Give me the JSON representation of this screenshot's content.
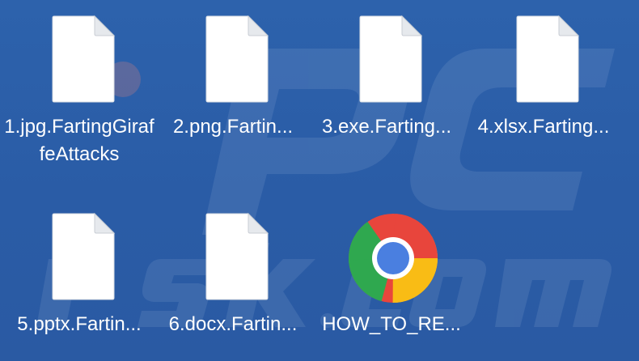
{
  "desktop": {
    "background_color": "#2b5ea8",
    "watermark_text": "PC risk.com",
    "files": [
      {
        "name": "1.jpg.FartingGiraffeAttacks",
        "icon": "blank-file-icon"
      },
      {
        "name": "2.png.Fartin...",
        "icon": "blank-file-icon"
      },
      {
        "name": "3.exe.Farting...",
        "icon": "blank-file-icon"
      },
      {
        "name": "4.xlsx.Farting...",
        "icon": "blank-file-icon"
      },
      {
        "name": "5.pptx.Fartin...",
        "icon": "blank-file-icon"
      },
      {
        "name": "6.docx.Fartin...",
        "icon": "blank-file-icon"
      },
      {
        "name": "HOW_TO_RE...",
        "icon": "chrome-icon"
      }
    ]
  }
}
